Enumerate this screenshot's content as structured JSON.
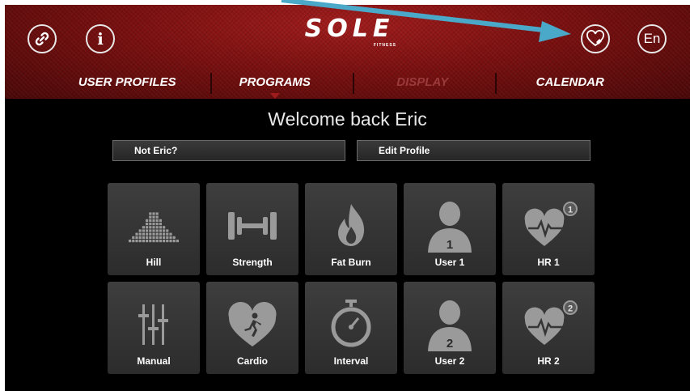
{
  "brand": {
    "logo": "SOLE",
    "sub": "FITNESS"
  },
  "header": {
    "info_glyph": "i",
    "language": "En"
  },
  "tabs": [
    {
      "label": "USER PROFILES",
      "state": "normal"
    },
    {
      "label": "PROGRAMS",
      "state": "active"
    },
    {
      "label": "DISPLAY",
      "state": "disabled"
    },
    {
      "label": "CALENDAR",
      "state": "normal"
    }
  ],
  "welcome": "Welcome back Eric",
  "actions": {
    "not_user": "Not Eric?",
    "edit_profile": "Edit Profile"
  },
  "programs": [
    {
      "label": "Hill",
      "icon": "hill-icon"
    },
    {
      "label": "Strength",
      "icon": "dumbbell-icon"
    },
    {
      "label": "Fat Burn",
      "icon": "flame-icon"
    },
    {
      "label": "User 1",
      "icon": "user-icon",
      "number": "1"
    },
    {
      "label": "HR 1",
      "icon": "heart-rate-icon",
      "number": "1"
    },
    {
      "label": "Manual",
      "icon": "sliders-icon"
    },
    {
      "label": "Cardio",
      "icon": "cardio-heart-icon"
    },
    {
      "label": "Interval",
      "icon": "stopwatch-icon"
    },
    {
      "label": "User 2",
      "icon": "user-icon",
      "number": "2"
    },
    {
      "label": "HR 2",
      "icon": "heart-rate-icon",
      "number": "2"
    }
  ],
  "colors": {
    "header_red": "#7a1010",
    "tile": "#353535",
    "annotation_arrow": "#4aa8c8"
  }
}
